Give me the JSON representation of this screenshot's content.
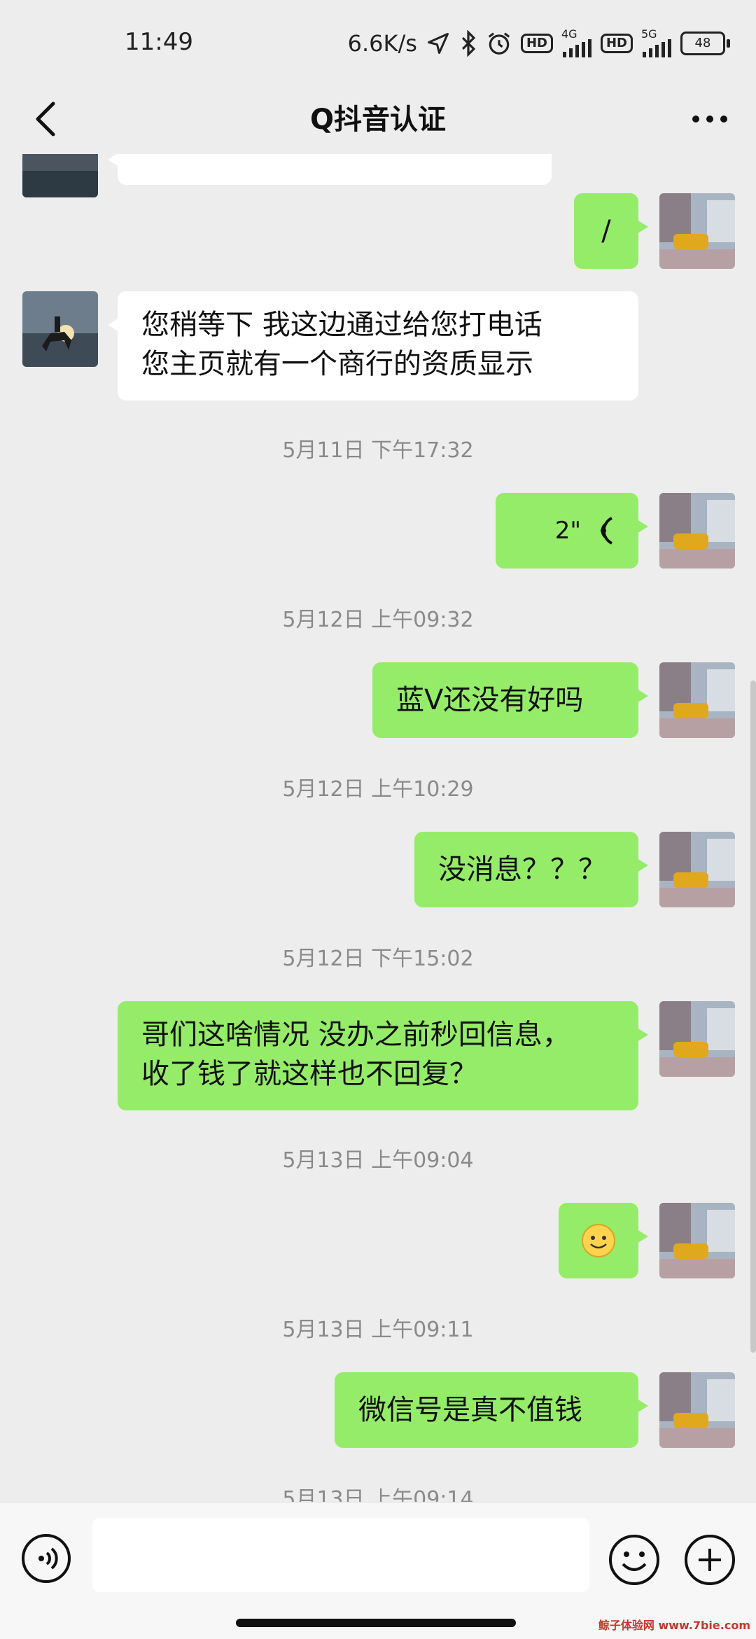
{
  "status_bar": {
    "time": "11:49",
    "net_speed": "6.6K/s",
    "hd1": "HD",
    "net1": "4G",
    "hd2": "HD",
    "net2": "5G",
    "battery": "48"
  },
  "header": {
    "title": "Q抖音认证"
  },
  "messages": [
    {
      "side": "me",
      "text": "/"
    },
    {
      "side": "other",
      "line1": "您稍等下  我这边通过给您打电话",
      "line2": "您主页就有一个商行的资质显示"
    },
    {
      "timestamp": "5月11日 下午17:32"
    },
    {
      "side": "me",
      "type": "voice",
      "duration": "2\""
    },
    {
      "timestamp": "5月12日 上午09:32"
    },
    {
      "side": "me",
      "text": "蓝V还没有好吗"
    },
    {
      "timestamp": "5月12日 上午10:29"
    },
    {
      "side": "me",
      "text": "没消息？？？"
    },
    {
      "timestamp": "5月12日 下午15:02"
    },
    {
      "side": "me",
      "line1": "哥们这啥情况 没办之前秒回信息，",
      "line2": "收了钱了就这样也不回复？"
    },
    {
      "timestamp": "5月13日 上午09:04"
    },
    {
      "side": "me",
      "type": "emoji",
      "emoji": "smile"
    },
    {
      "timestamp": "5月13日 上午09:11"
    },
    {
      "side": "me",
      "text": "微信号是真不值钱"
    },
    {
      "timestamp": "5月13日 上午09:14"
    }
  ],
  "input_bar": {
    "placeholder": ""
  },
  "watermark": "鲸子体验网 www.7bie.com",
  "icons": [
    "back-icon",
    "more-icon",
    "voice-input-icon",
    "emoji-icon",
    "plus-icon",
    "voice-wave-icon",
    "smile-emoji-icon"
  ],
  "colors": {
    "my_bubble": "#95ec69",
    "other_bubble": "#ffffff",
    "background": "#ededed"
  }
}
